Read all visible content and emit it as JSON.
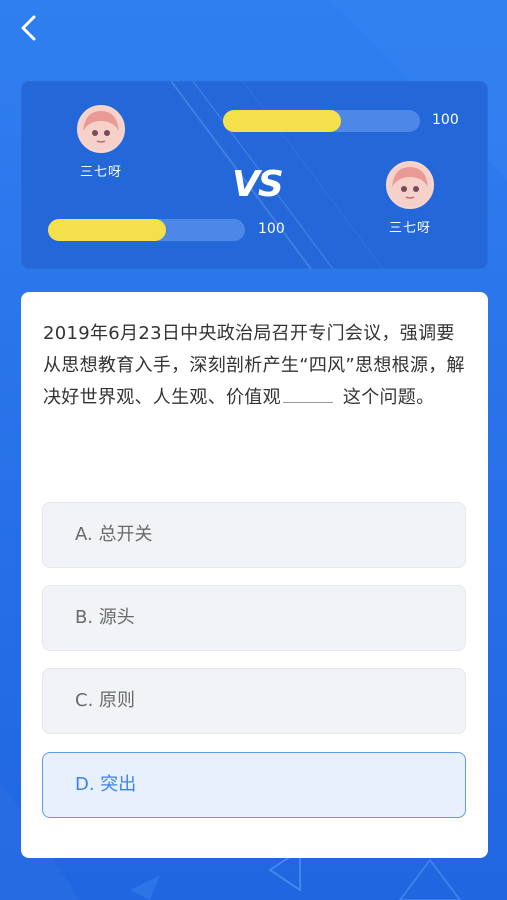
{
  "battle": {
    "vs_label": "VS",
    "player_top": {
      "name": "三七呀",
      "score": "100",
      "progress": 0.6
    },
    "player_bottom": {
      "name": "三七呀",
      "score": "100",
      "progress": 0.6
    }
  },
  "question": {
    "text_before": "2019年6月23日中央政治局召开专门会议，强调要从思想教育入手，深刻剖析产生“四风”思想根源，解决好世界观、人生观、价值观",
    "text_after": "这个问题。"
  },
  "options": [
    {
      "label": "A. 总开关"
    },
    {
      "label": "B. 源头"
    },
    {
      "label": "C. 原则"
    },
    {
      "label": "D. 突出"
    }
  ],
  "colors": {
    "accent": "#3b82f0",
    "bar_fill": "#f4e04a",
    "background": "#2a74ea"
  }
}
